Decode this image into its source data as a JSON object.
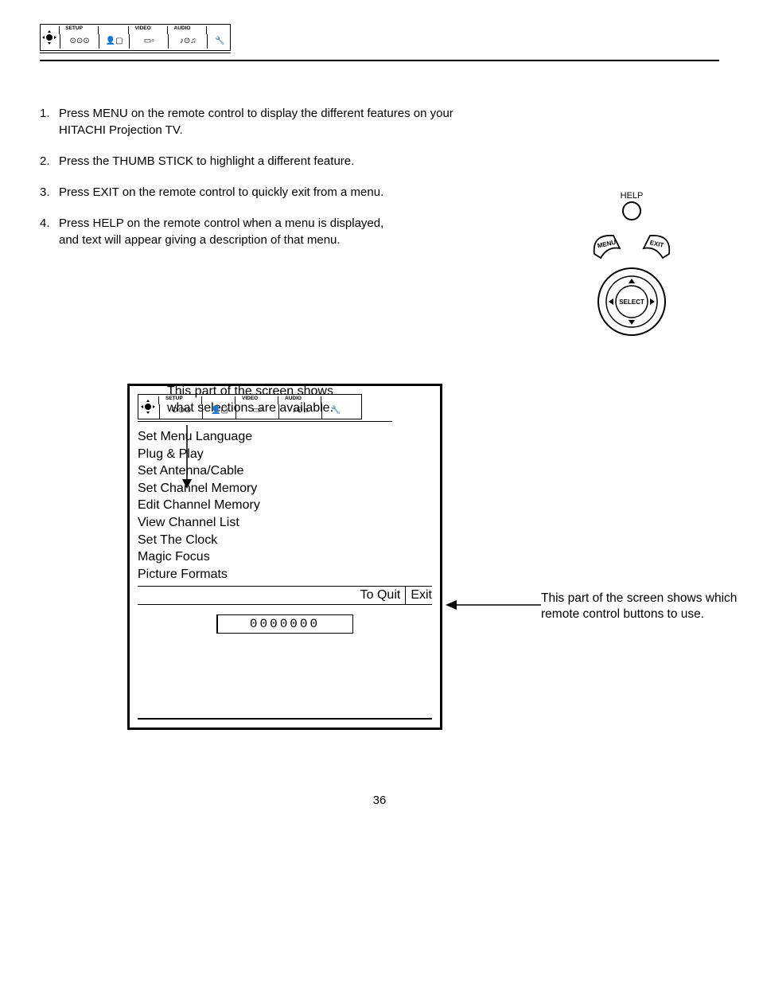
{
  "tabs": {
    "setup": "SETUP",
    "video": "VIDEO",
    "audio": "AUDIO"
  },
  "instructions": {
    "i1": "Press MENU on the remote control to display the different features on your HITACHI Projection TV.",
    "i2": "Press the THUMB STICK to highlight a different feature.",
    "i3": "Press EXIT on the remote control to quickly exit from a menu.",
    "i4a": "Press HELP on the remote control when a menu is displayed,",
    "i4b": "and text will appear giving a description of that menu."
  },
  "nums": {
    "n1": "1.",
    "n2": "2.",
    "n3": "3.",
    "n4": "4."
  },
  "remote": {
    "help": "HELP",
    "menu": "MENU",
    "exit": "EXIT",
    "select": "SELECT"
  },
  "annot": {
    "top1": "This part of the screen shows",
    "top2": "what selections are available.",
    "right1": "This part of the screen shows which",
    "right2": "remote control buttons to use."
  },
  "menu": {
    "m1": "Set Menu Language",
    "m2": "Plug & Play",
    "m3": "Set Antenna/Cable",
    "m4": "Set Channel Memory",
    "m5": "Edit Channel Memory",
    "m6": "View Channel List",
    "m7": "Set The Clock",
    "m8": "Magic Focus",
    "m9": "Picture Formats"
  },
  "quit": {
    "label": "To Quit",
    "btn": "Exit"
  },
  "digits": "0000000",
  "pagenum": "36"
}
